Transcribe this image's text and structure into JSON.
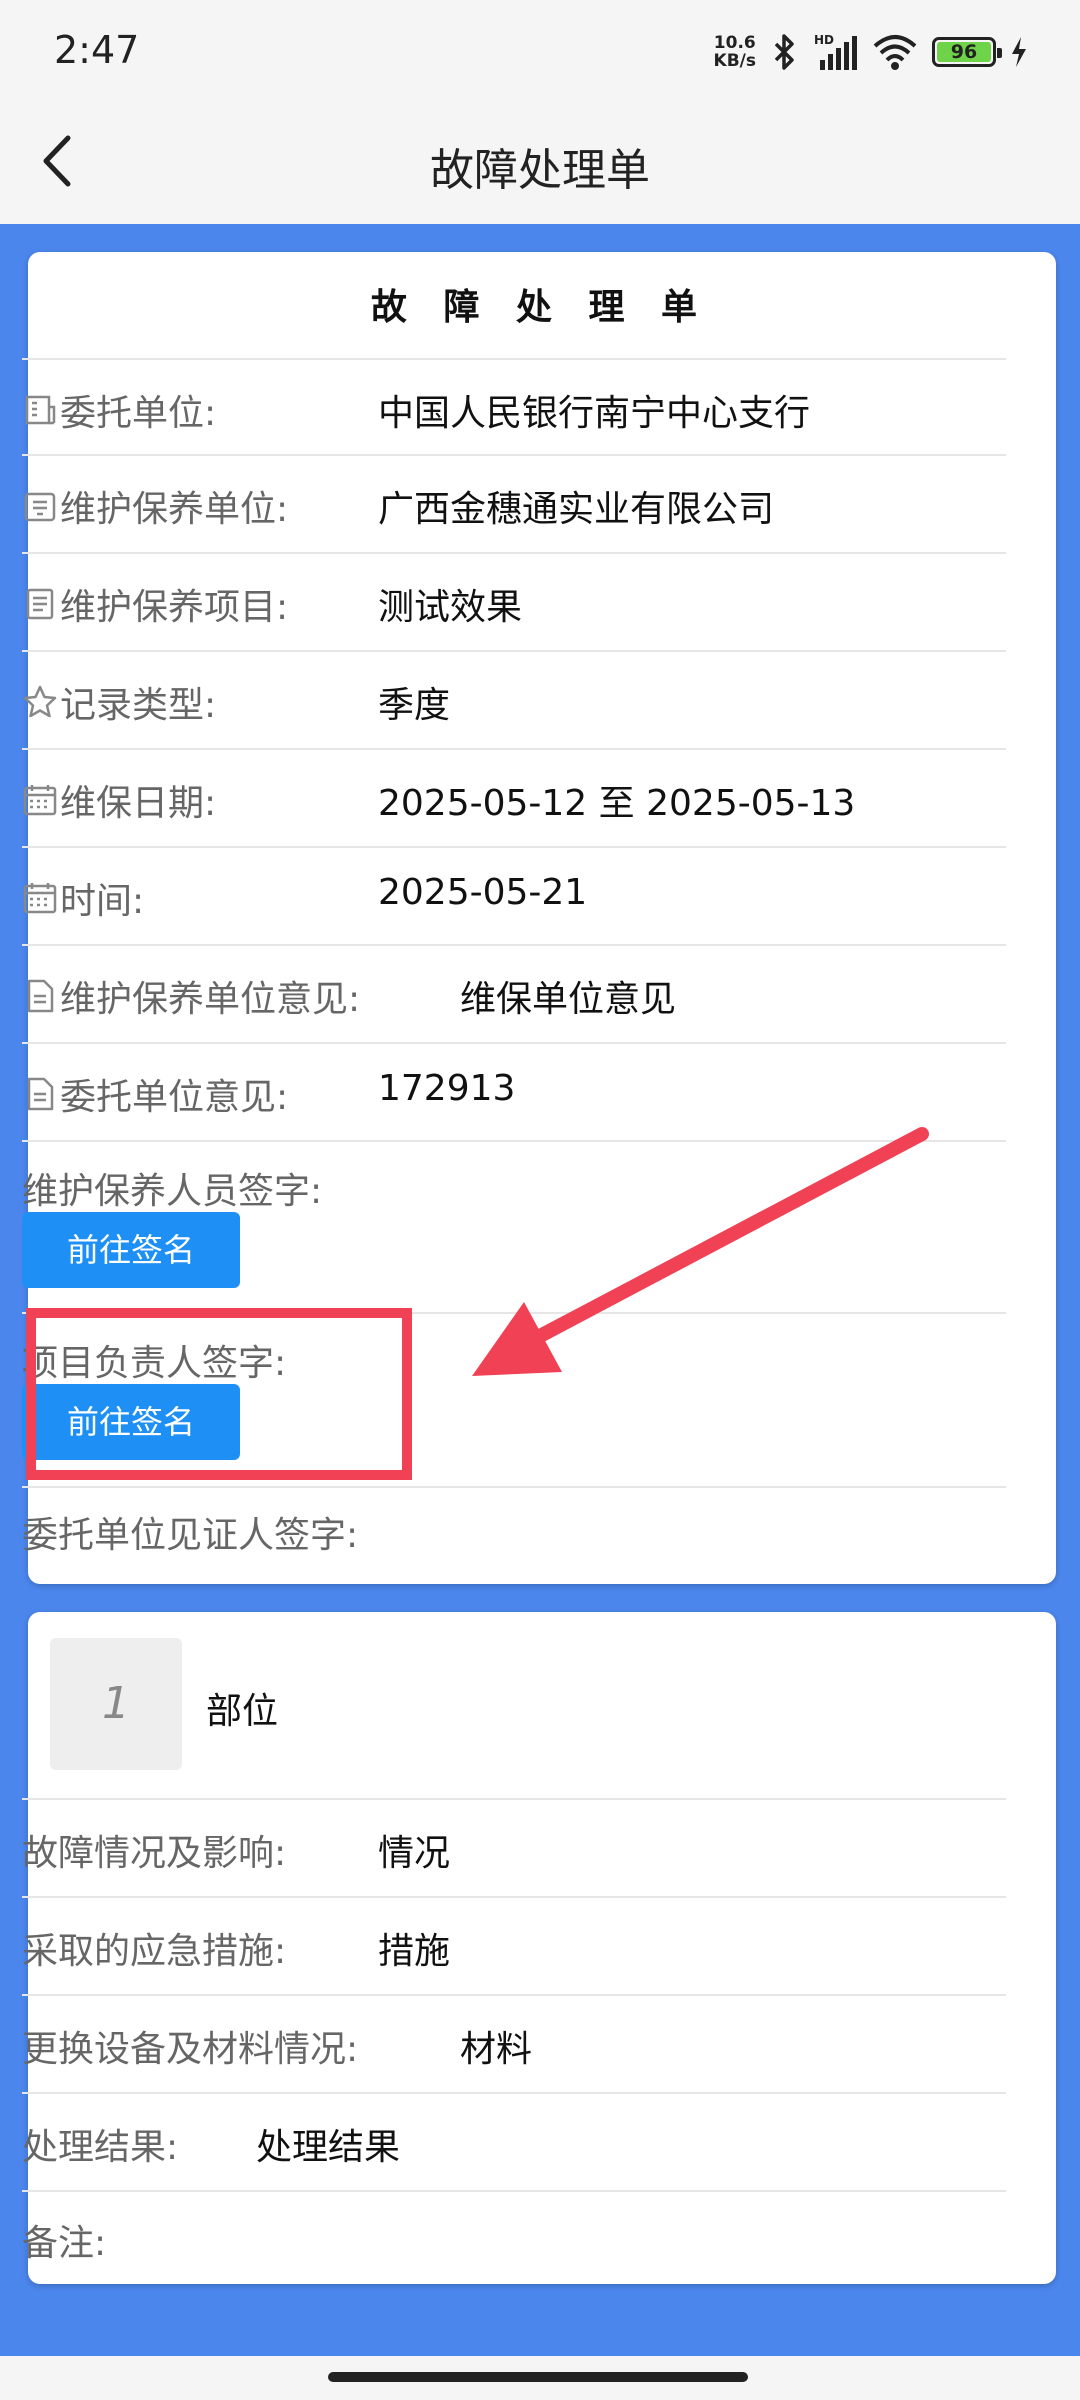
{
  "status_bar": {
    "time": "2:47",
    "net_speed_value": "10.6",
    "net_speed_unit": "KB/s",
    "battery_level": "96",
    "signal_label": "HD"
  },
  "app_bar": {
    "title": "故障处理单"
  },
  "form": {
    "heading": "故 障 处 理 单",
    "rows": [
      {
        "label": "委托单位:",
        "value": "中国人民银行南宁中心支行"
      },
      {
        "label": "维护保养单位:",
        "value": "广西金穗通实业有限公司"
      },
      {
        "label": "维护保养项目:",
        "value": "测试效果"
      },
      {
        "label": "记录类型:",
        "value": "季度"
      },
      {
        "label": "维保日期:",
        "value": "2025-05-12 至 2025-05-13"
      },
      {
        "label": "时间:",
        "value": "2025-05-21"
      },
      {
        "label": "维护保养单位意见:",
        "value": "维保单位意见"
      },
      {
        "label": "委托单位意见:",
        "value": "172913"
      }
    ],
    "signatures": [
      {
        "label": "维护保养人员签字:",
        "button": "前往签名"
      },
      {
        "label": "项目负责人签字:",
        "button": "前往签名"
      },
      {
        "label": "委托单位见证人签字:"
      }
    ]
  },
  "item": {
    "index": "1",
    "part": "部位",
    "rows": [
      {
        "label": "故障情况及影响:",
        "value": "情况"
      },
      {
        "label": "采取的应急措施:",
        "value": "措施"
      },
      {
        "label": "更换设备及材料情况:",
        "value": "材料"
      },
      {
        "label": "处理结果:",
        "value": "处理结果"
      },
      {
        "label": "备注:",
        "value": ""
      }
    ]
  },
  "colors": {
    "background_blue": "#4b86ec",
    "button_blue": "#1e90f5",
    "annotation_red": "#f04155"
  }
}
